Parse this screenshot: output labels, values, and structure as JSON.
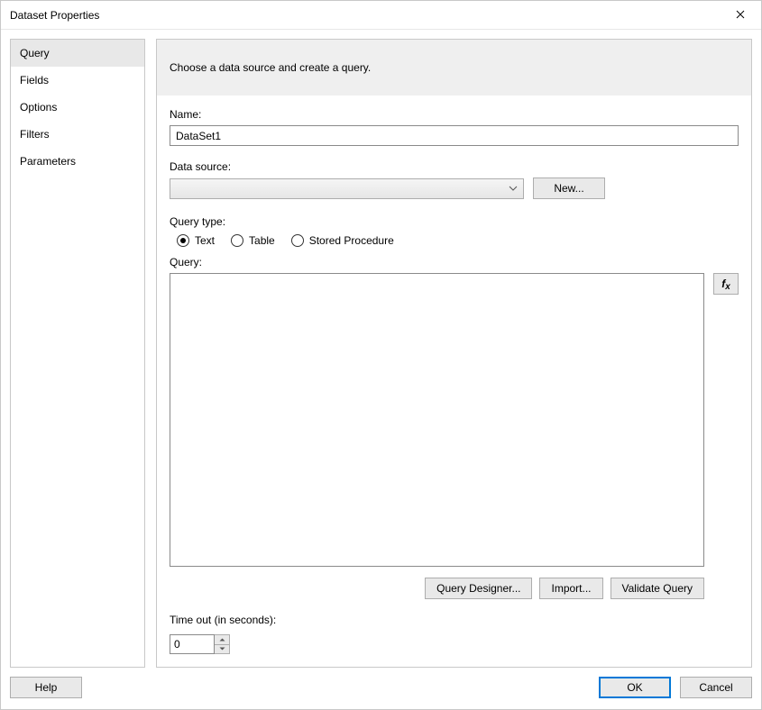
{
  "window": {
    "title": "Dataset Properties"
  },
  "sidebar": {
    "items": [
      {
        "label": "Query",
        "selected": true
      },
      {
        "label": "Fields",
        "selected": false
      },
      {
        "label": "Options",
        "selected": false
      },
      {
        "label": "Filters",
        "selected": false
      },
      {
        "label": "Parameters",
        "selected": false
      }
    ]
  },
  "header": {
    "title": "Choose a data source and create a query."
  },
  "form": {
    "name_label": "Name:",
    "name_value": "DataSet1",
    "datasource_label": "Data source:",
    "datasource_value": "",
    "new_button": "New...",
    "query_type_label": "Query type:",
    "query_types": [
      {
        "label": "Text",
        "selected": true
      },
      {
        "label": "Table",
        "selected": false
      },
      {
        "label": "Stored Procedure",
        "selected": false
      }
    ],
    "query_label": "Query:",
    "query_value": "",
    "fx_label": "fx",
    "query_designer_button": "Query Designer...",
    "import_button": "Import...",
    "validate_button": "Validate Query",
    "timeout_label": "Time out (in seconds):",
    "timeout_value": "0"
  },
  "footer": {
    "help": "Help",
    "ok": "OK",
    "cancel": "Cancel"
  }
}
